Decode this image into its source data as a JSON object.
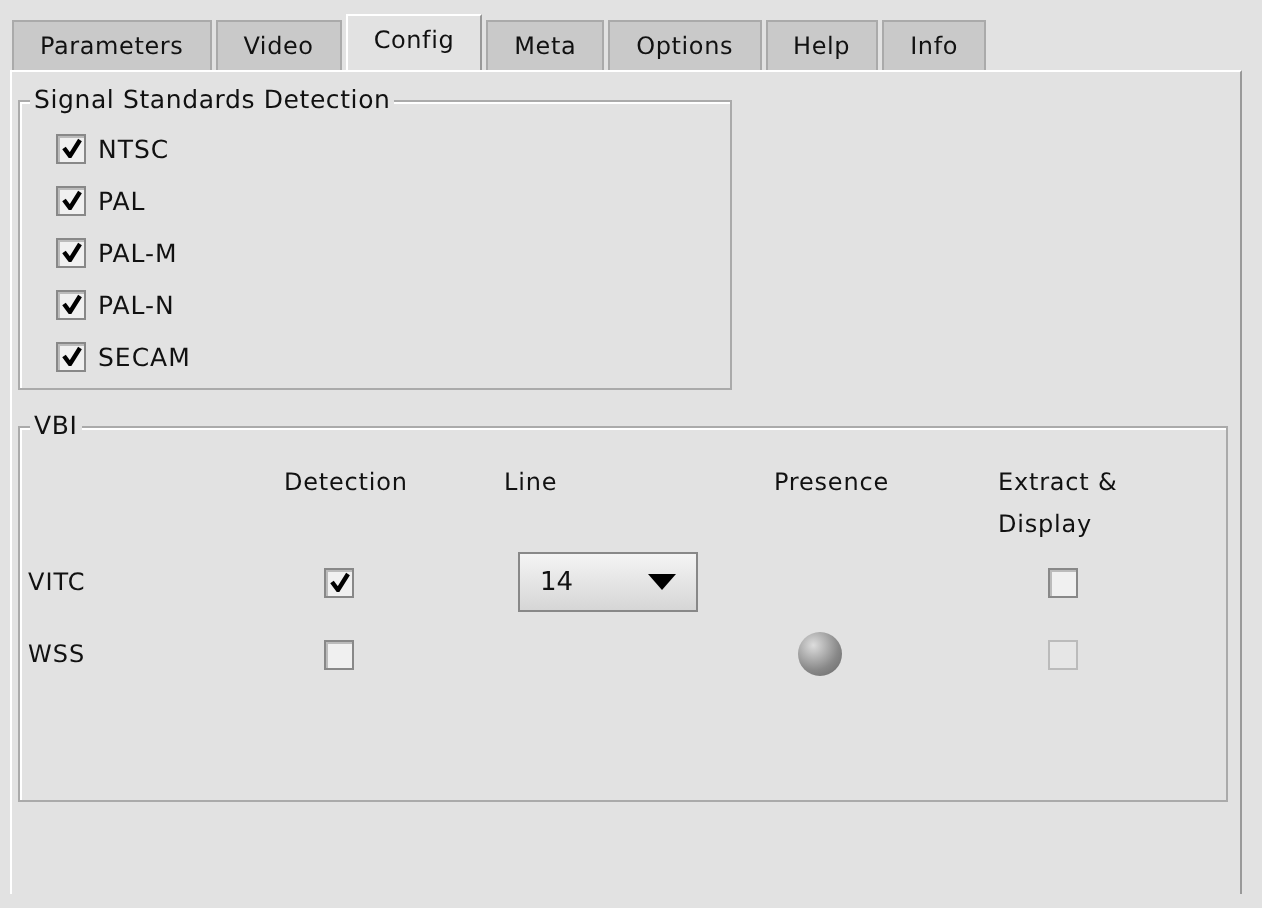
{
  "tabs": [
    {
      "label": "Parameters",
      "selected": false
    },
    {
      "label": "Video",
      "selected": false
    },
    {
      "label": "Config",
      "selected": true
    },
    {
      "label": "Meta",
      "selected": false
    },
    {
      "label": "Options",
      "selected": false
    },
    {
      "label": "Help",
      "selected": false
    },
    {
      "label": "Info",
      "selected": false
    }
  ],
  "signal_standards": {
    "title": "Signal Standards Detection",
    "items": [
      {
        "label": "NTSC",
        "checked": true
      },
      {
        "label": "PAL",
        "checked": true
      },
      {
        "label": "PAL-M",
        "checked": true
      },
      {
        "label": "PAL-N",
        "checked": true
      },
      {
        "label": "SECAM",
        "checked": true
      }
    ]
  },
  "vbi": {
    "title": "VBI",
    "columns": [
      "Detection",
      "Line",
      "Presence",
      "Extract &\nDisplay"
    ],
    "rows": [
      {
        "name": "VITC",
        "detection": true,
        "line": "14",
        "extract": {
          "checked": false,
          "disabled": false
        }
      },
      {
        "name": "WSS",
        "detection": false,
        "presence": true,
        "extract": {
          "checked": false,
          "disabled": true
        }
      }
    ]
  }
}
